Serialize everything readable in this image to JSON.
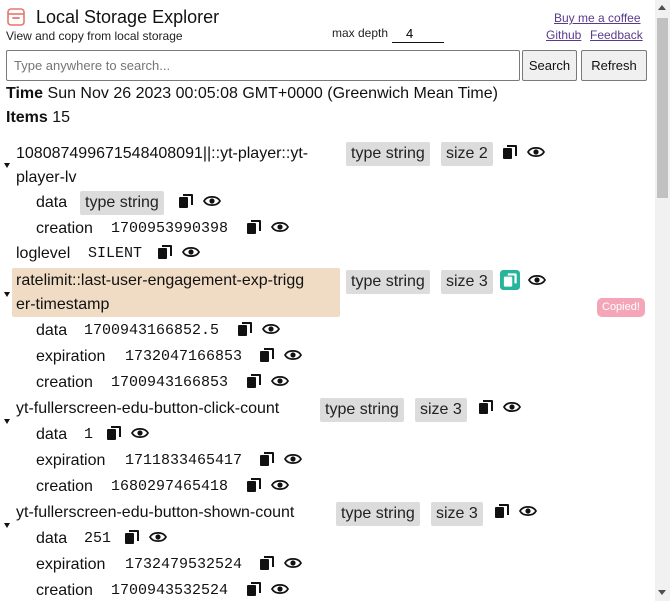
{
  "header": {
    "title": "Local Storage Explorer",
    "subtitle": "View and copy from local storage",
    "max_depth_label": "max depth",
    "max_depth_value": "4",
    "buy_coffee": "Buy me a coffee",
    "github": "Github",
    "feedback": "Feedback",
    "icon": "storage-icon"
  },
  "search": {
    "placeholder": "Type anywhere to search...",
    "search_label": "Search",
    "refresh_label": "Refresh"
  },
  "meta": {
    "time_label": "Time",
    "time_value": "Sun Nov 26 2023 00:05:08 GMT+0000 (Greenwich Mean Time)",
    "items_label": "Items",
    "items_value": "15"
  },
  "toast": "Copied!",
  "entries": [
    {
      "key_line1": "1080874996715484080​91||::yt-player::yt-",
      "key_line2": "player-lv",
      "type": "type string",
      "size": "size 2",
      "children": [
        {
          "label": "data",
          "type": "type string"
        },
        {
          "label": "creation",
          "value": "1700953990398"
        }
      ]
    },
    {
      "key": "loglevel",
      "value": "SILENT"
    },
    {
      "key_line1": "ratelimit::last-user-engagement-exp-trigg",
      "key_line2": "er-timestamp",
      "type": "type string",
      "size": "size 3",
      "children": [
        {
          "label": "data",
          "value": "1700943166852.5"
        },
        {
          "label": "expiration",
          "value": "1732047166853"
        },
        {
          "label": "creation",
          "value": "1700943166853"
        }
      ]
    },
    {
      "key": "yt-fullerscreen-edu-button-click-count",
      "type": "type string",
      "size": "size 3",
      "children": [
        {
          "label": "data",
          "value": "1"
        },
        {
          "label": "expiration",
          "value": "1711833465417"
        },
        {
          "label": "creation",
          "value": "1680297465418"
        }
      ]
    },
    {
      "key": "yt-fullerscreen-edu-button-shown-count",
      "type": "type string",
      "size": "size 3",
      "children": [
        {
          "label": "data",
          "value": "251"
        },
        {
          "label": "expiration",
          "value": "1732479532524"
        },
        {
          "label": "creation",
          "value": "1700943532524"
        }
      ]
    }
  ],
  "colors": {
    "highlight": "#f0dcc4",
    "tag_bg": "#dcdcdc",
    "copied_icon": "#26b59a",
    "toast_bg": "#f4a6b8",
    "link": "#5b3a8c"
  }
}
